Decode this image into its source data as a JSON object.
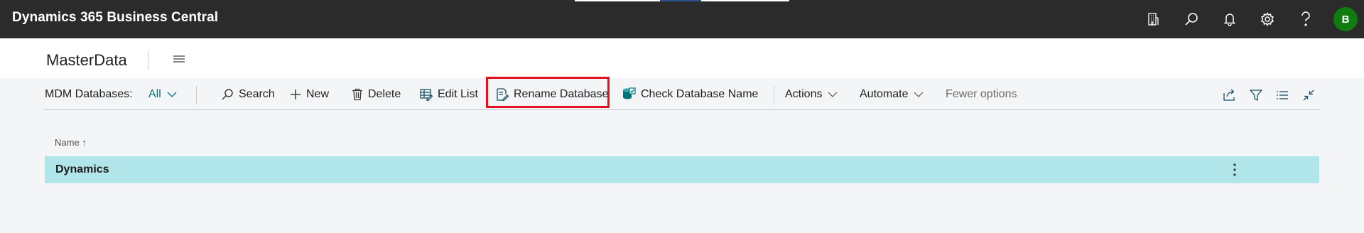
{
  "topbar": {
    "app_title": "Dynamics 365 Business Central",
    "icons": [
      "company-icon",
      "search-icon",
      "bell-icon",
      "gear-icon",
      "help-icon"
    ],
    "avatar_initial": "B",
    "avatar_color": "#107c10"
  },
  "page": {
    "title": "MasterData"
  },
  "actionbar": {
    "list_label": "MDM Databases:",
    "filter_value": "All",
    "search_label": "Search",
    "new_label": "New",
    "delete_label": "Delete",
    "edit_list_label": "Edit List",
    "rename_label": "Rename Database",
    "check_name_label": "Check Database Name",
    "actions_label": "Actions",
    "automate_label": "Automate",
    "fewer_options_label": "Fewer options",
    "accent_color": "#00737a",
    "highlight_color": "#e3101e"
  },
  "table": {
    "columns": [
      {
        "label": "Name ↑"
      }
    ],
    "rows": [
      {
        "name": "Dynamics"
      }
    ],
    "selected_row_color": "#b0e6ea"
  }
}
